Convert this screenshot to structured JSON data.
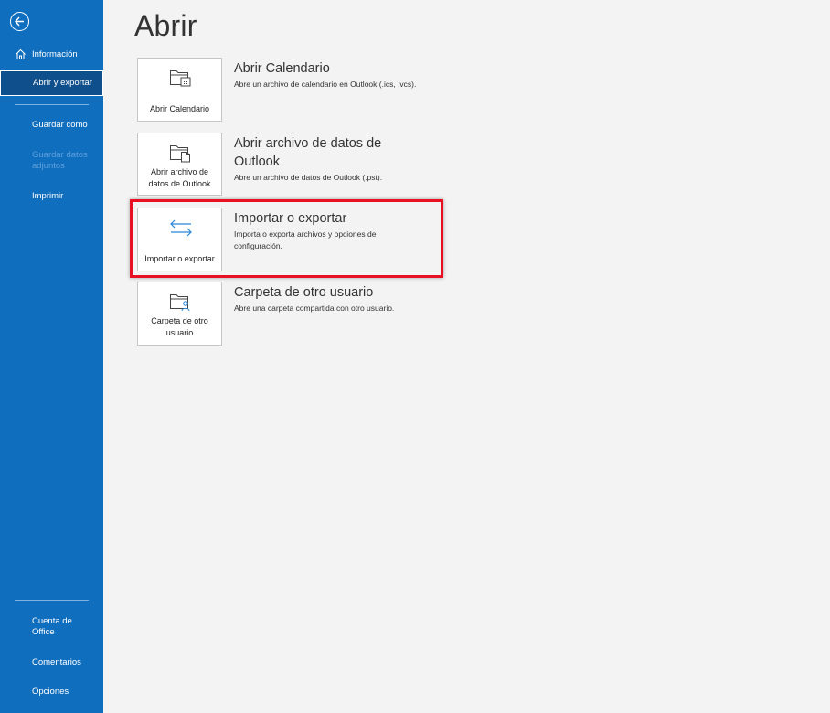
{
  "sidebar": {
    "items": [
      {
        "label": "Información"
      },
      {
        "label": "Abrir y exportar"
      },
      {
        "label": "Guardar como"
      },
      {
        "label": "Guardar datos adjuntos"
      },
      {
        "label": "Imprimir"
      },
      {
        "label": "Cuenta de Office"
      },
      {
        "label": "Comentarios"
      },
      {
        "label": "Opciones"
      }
    ]
  },
  "main": {
    "title": "Abrir",
    "options": [
      {
        "tile_label": "Abrir Calendario",
        "title": "Abrir Calendario",
        "description": "Abre un archivo de calendario en Outlook (.ics, .vcs).",
        "icon": "calendar-folder-icon"
      },
      {
        "tile_label": "Abrir archivo de datos de Outlook",
        "title": "Abrir archivo de datos de Outlook",
        "description": "Abre un archivo de datos de Outlook (.pst).",
        "icon": "data-file-folder-icon"
      },
      {
        "tile_label": "Importar o exportar",
        "title": "Importar o exportar",
        "description": "Importa o exporta archivos y opciones de configuración.",
        "icon": "import-export-arrows-icon"
      },
      {
        "tile_label": "Carpeta de otro usuario",
        "title": "Carpeta de otro usuario",
        "description": "Abre una carpeta compartida con otro usuario.",
        "icon": "shared-folder-user-icon"
      }
    ]
  },
  "colors": {
    "sidebar_bg": "#106ebe",
    "selected_bg": "#0f4f8c",
    "highlight": "#e81123"
  }
}
